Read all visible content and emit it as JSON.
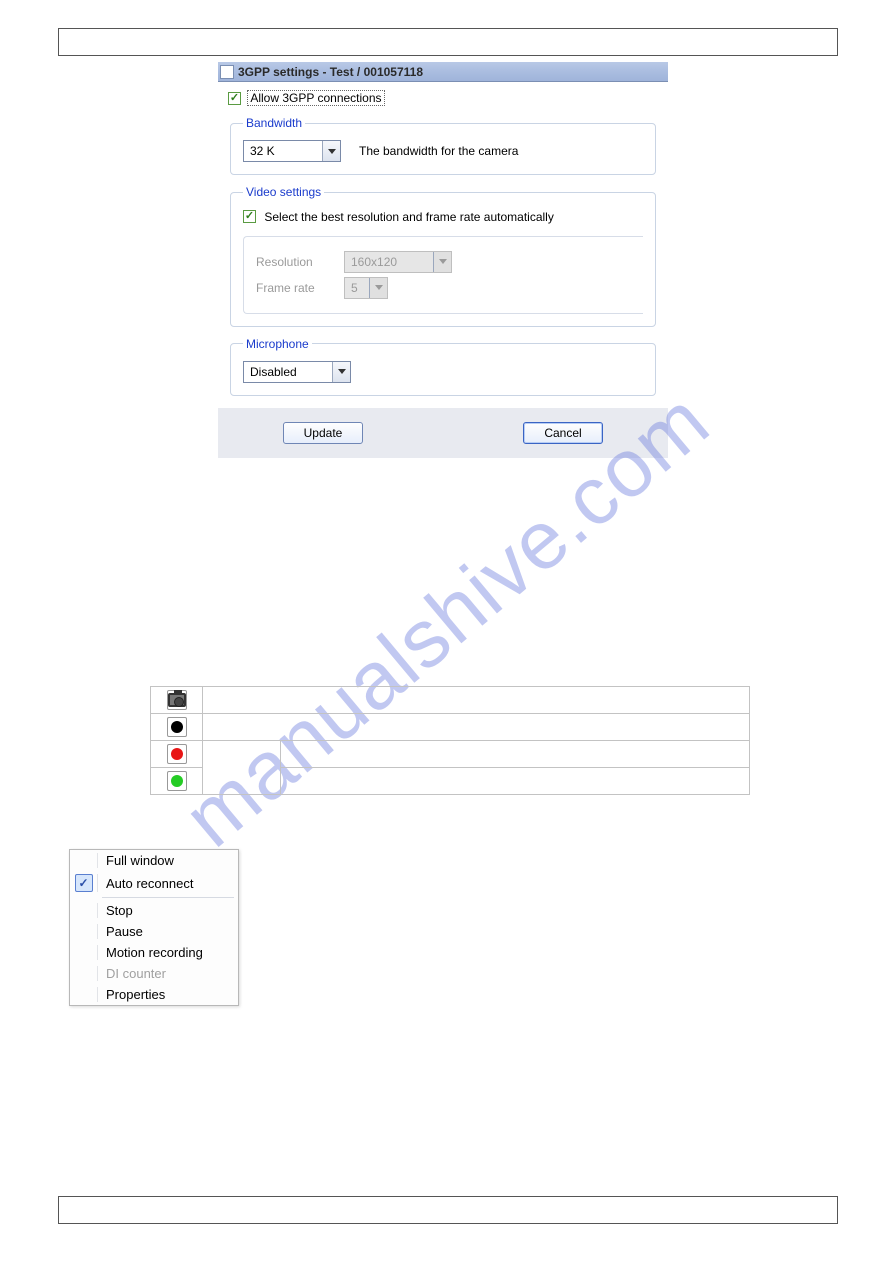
{
  "dialog": {
    "title": "3GPP settings - Test / 001057118",
    "allow_label": "Allow 3GPP connections",
    "bandwidth": {
      "legend": "Bandwidth",
      "value": "32 K",
      "desc": "The bandwidth for the camera"
    },
    "video": {
      "legend": "Video settings",
      "auto_label": "Select the best resolution and frame rate automatically",
      "resolution_label": "Resolution",
      "resolution_value": "160x120",
      "framerate_label": "Frame rate",
      "framerate_value": "5"
    },
    "microphone": {
      "legend": "Microphone",
      "value": "Disabled"
    },
    "update_btn": "Update",
    "cancel_btn": "Cancel"
  },
  "watermark": "manualshive.com",
  "context_menu": {
    "items": [
      {
        "label": "Full window",
        "disabled": false
      },
      {
        "label": "Auto reconnect",
        "checked": true,
        "disabled": false
      },
      {
        "label": "Stop",
        "disabled": false
      },
      {
        "label": "Pause",
        "disabled": false
      },
      {
        "label": "Motion recording",
        "disabled": false
      },
      {
        "label": "DI counter",
        "disabled": true
      },
      {
        "label": "Properties",
        "disabled": false
      }
    ]
  }
}
